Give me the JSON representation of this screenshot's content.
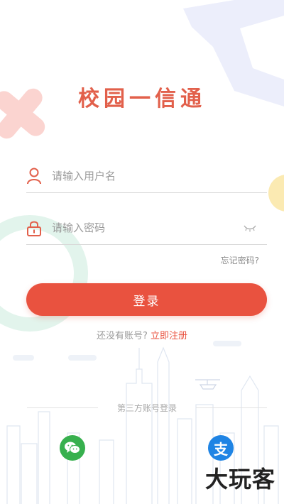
{
  "app": {
    "title": "校园一信通"
  },
  "login": {
    "username_placeholder": "请输入用户名",
    "password_placeholder": "请输入密码",
    "forgot_label": "忘记密码?",
    "login_label": "登录",
    "no_account_text": "还没有账号?",
    "register_label": "立即注册"
  },
  "third_party": {
    "label": "第三方账号登录",
    "providers": [
      {
        "name": "wechat",
        "icon": "wechat-icon",
        "color": "#37b04e"
      },
      {
        "name": "alipay",
        "icon": "alipay-icon",
        "glyph": "支",
        "color": "#1f84e4"
      }
    ]
  },
  "watermark": {
    "text": "大玩客"
  },
  "colors": {
    "accent": "#e9523f",
    "title": "#e2604b"
  }
}
